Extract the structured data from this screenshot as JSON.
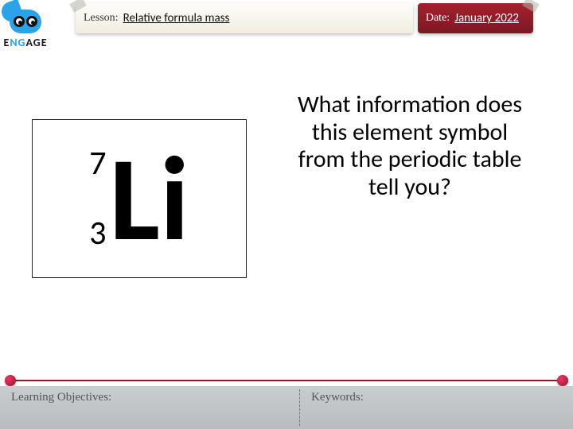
{
  "brand": {
    "left": "E",
    "mid": "NG",
    "right": "AGE"
  },
  "header": {
    "lesson_label": "Lesson:",
    "lesson_value": "Relative formula mass",
    "date_label": "Date:",
    "date_value": "January 2022"
  },
  "element": {
    "mass_number": "7",
    "atomic_number": "3",
    "symbol": "Li"
  },
  "question": "What information does this element symbol from the periodic table tell you?",
  "footer": {
    "objectives_label": "Learning Objectives:",
    "keywords_label": "Keywords:"
  }
}
